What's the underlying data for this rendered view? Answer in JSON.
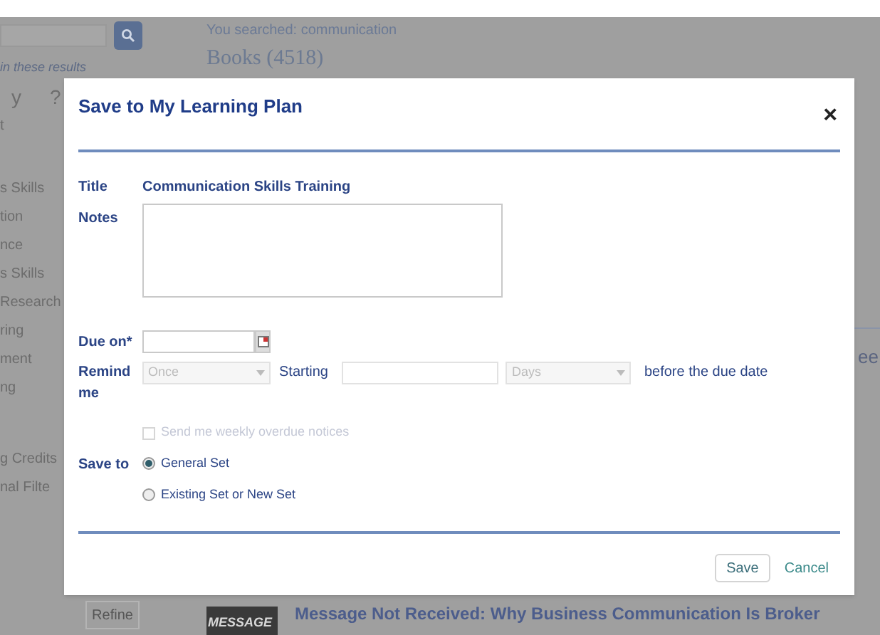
{
  "background": {
    "search_summary": "You searched: communication",
    "section_heading": "Books (4518)",
    "refine_hint": "in these results",
    "sidebar_items": [
      "y",
      "?",
      "t",
      "s Skills",
      "tion",
      "nce",
      "s Skills",
      "Research",
      "ring",
      "ment",
      "ng",
      "g Credits",
      "nal Filte"
    ],
    "refine_button": "Refine",
    "result_thumbnail_text": "MESSAGE",
    "result_title": "Message Not Received: Why Business Communication Is Broker",
    "right_fragment": "ee"
  },
  "dialog": {
    "title": "Save to My Learning Plan",
    "close": "×",
    "fields": [
      {
        "label": "Title",
        "value": "Communication Skills Training"
      },
      {
        "label": "Notes"
      },
      {
        "label": "Due on*"
      }
    ],
    "remind": {
      "label": "Remind me",
      "frequency": "Once",
      "starting_label": "Starting",
      "unit": "Days",
      "suffix": "before the due date",
      "disabled": true
    },
    "weekly_notice": {
      "label": "Send me weekly overdue notices",
      "checked": false,
      "disabled": true
    },
    "save_to": {
      "label": "Save to",
      "options": [
        {
          "label": "General Set",
          "selected": true
        },
        {
          "label": "Existing Set or New Set",
          "selected": false
        }
      ]
    },
    "buttons": {
      "save": "Save",
      "cancel": "Cancel"
    }
  }
}
